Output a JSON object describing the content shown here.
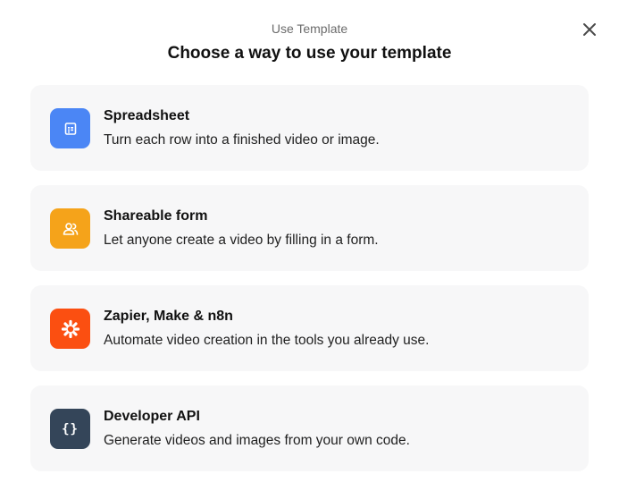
{
  "header": {
    "subtitle": "Use Template",
    "title": "Choose a way to use your template"
  },
  "colors": {
    "spreadsheet": "#4b86f5",
    "form": "#f5a31a",
    "automation": "#fb4f11",
    "api": "#344559"
  },
  "options": [
    {
      "title": "Spreadsheet",
      "description": "Turn each row into a finished video or image.",
      "icon": "spreadsheet-icon"
    },
    {
      "title": "Shareable form",
      "description": "Let anyone create a video by filling in a form.",
      "icon": "users-icon"
    },
    {
      "title": "Zapier, Make & n8n",
      "description": "Automate video creation in the tools you already use.",
      "icon": "asterisk-icon"
    },
    {
      "title": "Developer API",
      "description": "Generate videos and images from your own code.",
      "icon": "braces-icon",
      "glyph": "{}"
    }
  ]
}
